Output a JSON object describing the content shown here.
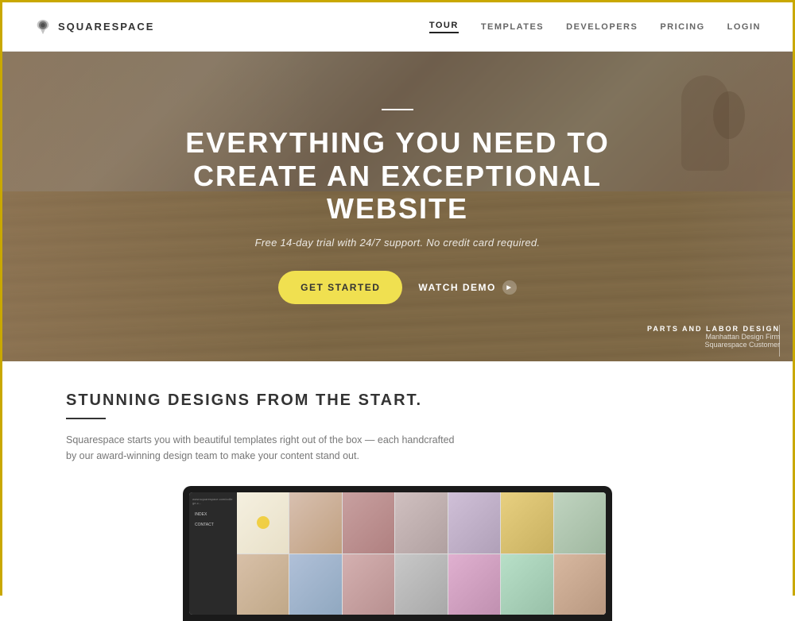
{
  "header": {
    "logo_text": "SQUARESPACE",
    "nav_items": [
      {
        "id": "tour",
        "label": "TOUR",
        "active": true
      },
      {
        "id": "templates",
        "label": "TEMPLATES",
        "active": false
      },
      {
        "id": "developers",
        "label": "DEVELOPERS",
        "active": false
      },
      {
        "id": "pricing",
        "label": "PRICING",
        "active": false
      },
      {
        "id": "login",
        "label": "LOGIN",
        "active": false
      }
    ]
  },
  "hero": {
    "divider": "",
    "title": "EVERYTHING YOU NEED TO CREATE AN EXCEPTIONAL WEBSITE",
    "subtitle": "Free 14-day trial with 24/7 support. No credit card required.",
    "cta_label": "GET STARTED",
    "demo_label": "WATCH DEMO",
    "attribution_name": "PARTS AND LABOR DESIGN",
    "attribution_sub1": "Manhattan Design Firm",
    "attribution_sub2": "Squarespace Customer"
  },
  "section2": {
    "title": "STUNNING DESIGNS FROM THE START.",
    "description": "Squarespace starts you with beautiful templates right out of the box — each handcrafted by our award-winning design team to make your content stand out.",
    "laptop": {
      "sidebar_url": "www.squarespace.com/college-c...",
      "sidebar_items": [
        "INDEX",
        "CONTACT"
      ]
    }
  },
  "colors": {
    "accent_yellow": "#f0e050",
    "nav_active": "#222222",
    "nav_inactive": "#888888"
  }
}
